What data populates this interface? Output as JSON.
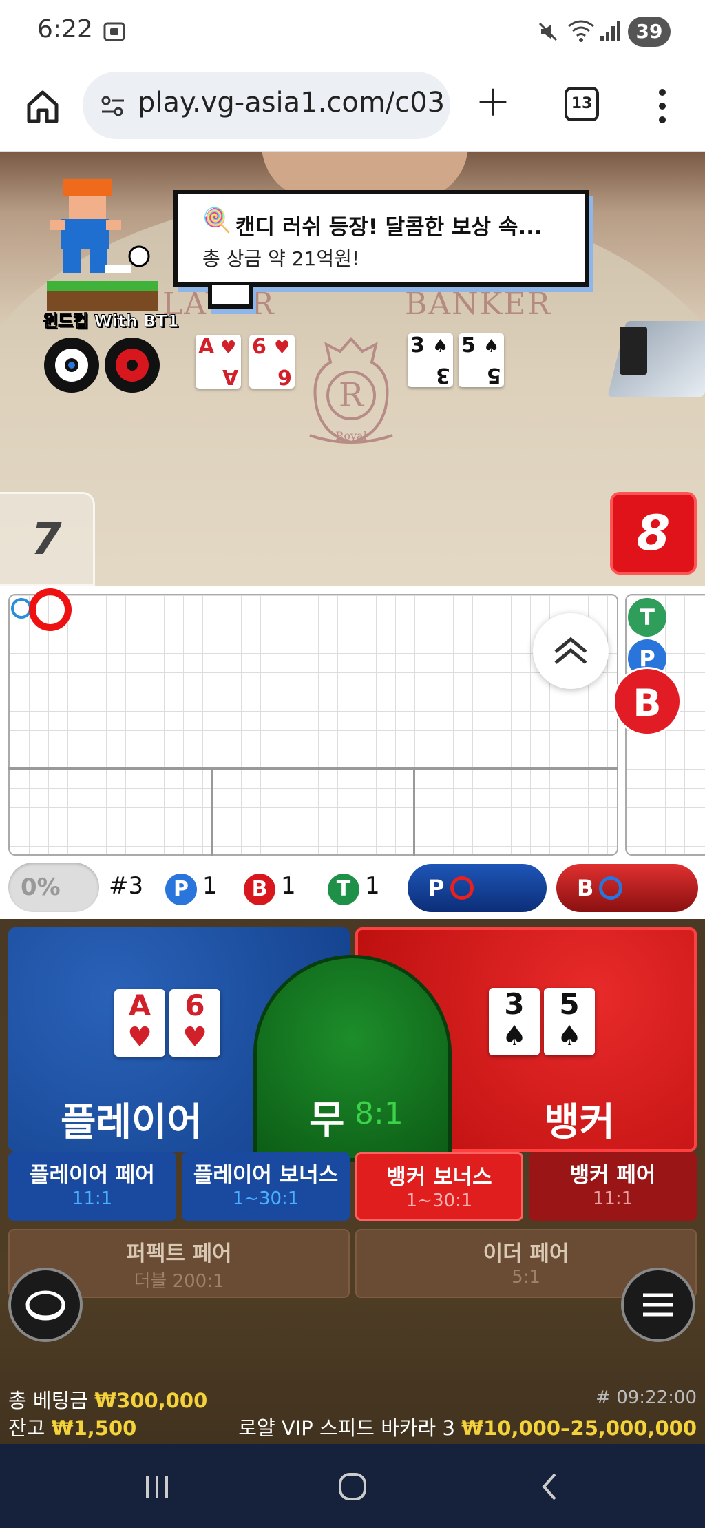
{
  "status_bar": {
    "time": "6:22",
    "battery": "39"
  },
  "browser": {
    "url": "play.vg-asia1.com/c03",
    "tab_count": "13"
  },
  "video": {
    "promo_title": "캔디 러쉬 등장! 달콤한 보상 속...",
    "promo_sub": "총 상금 약 21억원!",
    "mascot_name": "윈드컵 With BT1",
    "table_label_player": "LAYER",
    "table_label_banker": "BANKER",
    "crest_letter": "R",
    "crest_word": "Royal",
    "player_cards": [
      {
        "rank": "A",
        "suit": "♥"
      },
      {
        "rank": "6",
        "suit": "♥"
      }
    ],
    "banker_cards": [
      {
        "rank": "3",
        "suit": "♠"
      },
      {
        "rank": "5",
        "suit": "♠"
      }
    ],
    "player_score": "7",
    "banker_score": "8"
  },
  "roadmap": {
    "side_t": "T",
    "side_p": "P",
    "side_b": "B"
  },
  "stats": {
    "percent": "0%",
    "shoe": "#3",
    "p_label": "P",
    "p_count": "1",
    "b_label": "B",
    "b_count": "1",
    "t_label": "T",
    "t_count": "1",
    "predict_p": "P",
    "predict_b": "B"
  },
  "bets": {
    "player": "플레이어",
    "banker": "뱅커",
    "tie": "무",
    "tie_odds": "8:1",
    "player_cards": [
      {
        "rank": "A",
        "suit": "♥"
      },
      {
        "rank": "6",
        "suit": "♥"
      }
    ],
    "banker_cards": [
      {
        "rank": "3",
        "suit": "♠"
      },
      {
        "rank": "5",
        "suit": "♠"
      }
    ],
    "player_pair": "플레이어 페어",
    "player_pair_odds": "11:1",
    "player_bonus": "플레이어 보너스",
    "player_bonus_odds": "1~30:1",
    "banker_bonus": "뱅커 보너스",
    "banker_bonus_odds": "1~30:1",
    "banker_pair": "뱅커 페어",
    "banker_pair_odds": "11:1",
    "perfect_pair": "퍼펙트 페어",
    "perfect_pair_odds": "더블 200:1",
    "either_pair": "이더 페어",
    "either_pair_odds": "5:1"
  },
  "info": {
    "total_bet_label": "총 베팅금",
    "total_bet": "₩300,000",
    "balance_label": "잔고",
    "balance": "₩1,500",
    "round_id": "# 09:22:00",
    "table_name": "로얄 VIP 스피드 바카라 3",
    "limits": "₩10,000–25,000,000"
  },
  "colors": {
    "player": "#1a4aa0",
    "banker": "#e01e1e",
    "tie": "#1d8d2a",
    "accent": "#f3d23a"
  }
}
